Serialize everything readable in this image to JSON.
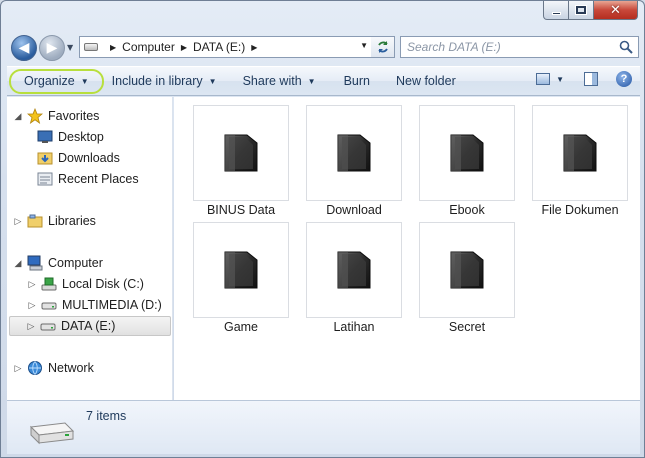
{
  "window": {
    "caption": {
      "minimize": "minimize",
      "maximize": "maximize",
      "close": "close"
    }
  },
  "address_bar": {
    "drive_icon": "drive-icon",
    "crumbs": [
      "Computer",
      "DATA (E:)"
    ],
    "refresh_icon": "refresh-icon"
  },
  "search": {
    "placeholder": "Search DATA (E:)",
    "icon": "magnifier-icon"
  },
  "toolbar": {
    "organize": "Organize",
    "include_in_library": "Include in library",
    "share_with": "Share with",
    "burn": "Burn",
    "new_folder": "New folder",
    "help_glyph": "?"
  },
  "navigation": {
    "favorites": {
      "label": "Favorites",
      "items": [
        "Desktop",
        "Downloads",
        "Recent Places"
      ]
    },
    "libraries": {
      "label": "Libraries"
    },
    "computer": {
      "label": "Computer",
      "items": [
        "Local Disk (C:)",
        "MULTIMEDIA (D:)",
        "DATA (E:)"
      ],
      "selected": "DATA (E:)"
    },
    "network": {
      "label": "Network"
    }
  },
  "folders": [
    {
      "name": "BINUS Data"
    },
    {
      "name": "Download"
    },
    {
      "name": "Ebook"
    },
    {
      "name": "File Dokumen"
    },
    {
      "name": "Game"
    },
    {
      "name": "Latihan"
    },
    {
      "name": "Secret"
    }
  ],
  "details": {
    "item_count": "7 items"
  },
  "colors": {
    "organize_highlight": "#b8df3d",
    "command_text": "#1e395b",
    "close_button": "#c8483a"
  }
}
